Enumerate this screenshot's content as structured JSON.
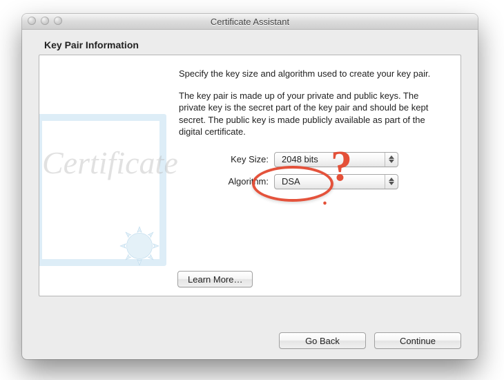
{
  "window": {
    "title": "Certificate Assistant"
  },
  "heading": "Key Pair Information",
  "paragraph1": "Specify the key size and algorithm used to create your key pair.",
  "paragraph2": "The key pair is made up of your private and public keys. The private key is the secret part of the key pair and should be kept secret. The public key is made publicly available as part of the digital certificate.",
  "form": {
    "keysize": {
      "label": "Key Size:",
      "value": "2048 bits"
    },
    "algorithm": {
      "label": "Algorithm:",
      "value": "DSA"
    }
  },
  "buttons": {
    "learn_more": "Learn More…",
    "go_back": "Go Back",
    "continue": "Continue"
  },
  "certificate_watermark": "Certificate",
  "annotation": {
    "mark": "?"
  },
  "colors": {
    "annotation": "#e34a32"
  }
}
